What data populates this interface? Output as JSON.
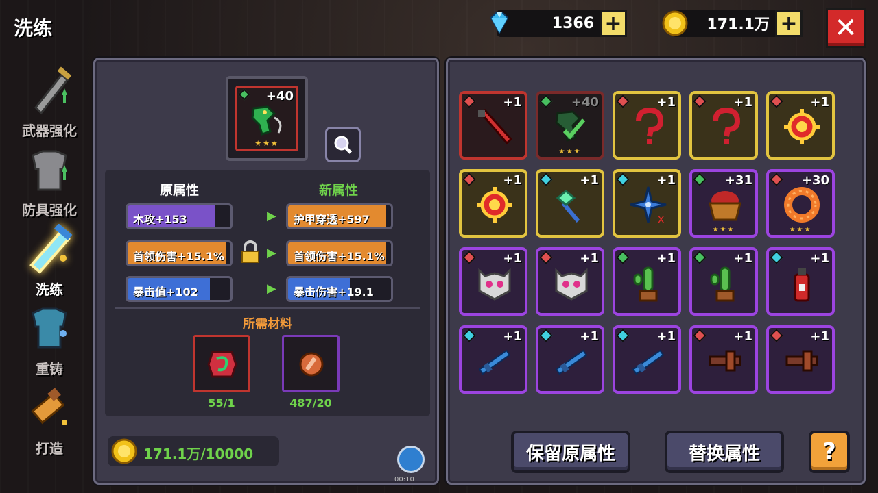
{
  "header": {
    "title": "洗练",
    "gems": "1366",
    "gold": "171.1万",
    "plus_label": "+",
    "close_label": "✕"
  },
  "sidebar": {
    "items": [
      {
        "label": "武器强化",
        "icon": "sword-icon",
        "active": false
      },
      {
        "label": "防具强化",
        "icon": "armor-icon",
        "active": false
      },
      {
        "label": "洗练",
        "icon": "crystal-sword-icon",
        "active": true
      },
      {
        "label": "重铸",
        "icon": "blue-armor-icon",
        "active": false
      },
      {
        "label": "打造",
        "icon": "forge-icon",
        "active": false
      }
    ]
  },
  "equipment": {
    "level": "+40",
    "stars": "★★★",
    "icon": "green-serpent-bow-icon"
  },
  "attributes": {
    "original_title": "原属性",
    "new_title": "新属性",
    "original": [
      {
        "text": "木攻+153",
        "fill": 0.85,
        "color": "#7a52c8"
      },
      {
        "text": "首领伤害+15.1%",
        "fill": 0.95,
        "color": "#e38a2f"
      },
      {
        "text": "暴击值+102",
        "fill": 0.8,
        "color": "#3e6fd6"
      }
    ],
    "new": [
      {
        "text": "护甲穿透+597",
        "fill": 0.95,
        "color": "#e38a2f"
      },
      {
        "text": "首领伤害+15.1%",
        "fill": 0.95,
        "color": "#e38a2f"
      },
      {
        "text": "暴击伤害+19.1",
        "fill": 0.6,
        "color": "#3e6fd6"
      }
    ]
  },
  "materials": {
    "title": "所需材料",
    "items": [
      {
        "count": "55/1",
        "icon": "serpent-gem-icon"
      },
      {
        "count": "487/20",
        "icon": "copper-coin-icon"
      }
    ]
  },
  "cost": {
    "text": "171.1万/10000"
  },
  "record": {
    "time": "00:10"
  },
  "inventory": [
    {
      "level": "+1",
      "rarity": "red",
      "gem": "#e05050",
      "icon": "red-sword-icon",
      "stars": ""
    },
    {
      "level": "+40",
      "rarity": "red-dim",
      "gem": "#48c060",
      "icon": "serpent-bow-icon",
      "stars": "★★★"
    },
    {
      "level": "+1",
      "rarity": "gold",
      "gem": "#e05050",
      "icon": "red-hook-icon",
      "stars": ""
    },
    {
      "level": "+1",
      "rarity": "gold",
      "gem": "#e05050",
      "icon": "red-hook-icon",
      "stars": ""
    },
    {
      "level": "+1",
      "rarity": "gold",
      "gem": "#e05050",
      "icon": "sun-orb-icon",
      "stars": ""
    },
    {
      "level": "+1",
      "rarity": "gold",
      "gem": "#e05050",
      "icon": "sun-orb-icon",
      "stars": ""
    },
    {
      "level": "+1",
      "rarity": "gold",
      "gem": "#40d0e0",
      "icon": "green-staff-icon",
      "stars": ""
    },
    {
      "level": "+1",
      "rarity": "gold",
      "gem": "#40d0e0",
      "icon": "blue-shuriken-icon",
      "stars": ""
    },
    {
      "level": "+31",
      "rarity": "purple",
      "gem": "#48c060",
      "icon": "fruit-basket-icon",
      "stars": "★★★"
    },
    {
      "level": "+30",
      "rarity": "purple",
      "gem": "#e05050",
      "icon": "donut-ring-icon",
      "stars": "★★★"
    },
    {
      "level": "+1",
      "rarity": "purple",
      "gem": "#e05050",
      "icon": "pink-eye-helmet-icon",
      "stars": ""
    },
    {
      "level": "+1",
      "rarity": "purple",
      "gem": "#e05050",
      "icon": "pink-eye-helmet-icon",
      "stars": ""
    },
    {
      "level": "+1",
      "rarity": "purple",
      "gem": "#48c060",
      "icon": "cactus-icon",
      "stars": ""
    },
    {
      "level": "+1",
      "rarity": "purple",
      "gem": "#48c060",
      "icon": "cactus-icon",
      "stars": ""
    },
    {
      "level": "+1",
      "rarity": "purple",
      "gem": "#40d0e0",
      "icon": "fire-extinguisher-icon",
      "stars": ""
    },
    {
      "level": "+1",
      "rarity": "purple",
      "gem": "#40d0e0",
      "icon": "blue-rifle-icon",
      "stars": ""
    },
    {
      "level": "+1",
      "rarity": "purple",
      "gem": "#40d0e0",
      "icon": "blue-rifle-icon",
      "stars": ""
    },
    {
      "level": "+1",
      "rarity": "purple",
      "gem": "#40d0e0",
      "icon": "blue-rifle-icon",
      "stars": ""
    },
    {
      "level": "+1",
      "rarity": "purple",
      "gem": "#e05050",
      "icon": "red-crossbow-icon",
      "stars": ""
    },
    {
      "level": "+1",
      "rarity": "purple",
      "gem": "#e05050",
      "icon": "red-crossbow-icon",
      "stars": ""
    }
  ],
  "buttons": {
    "keep": "保留原属性",
    "replace": "替换属性",
    "help": "?"
  }
}
